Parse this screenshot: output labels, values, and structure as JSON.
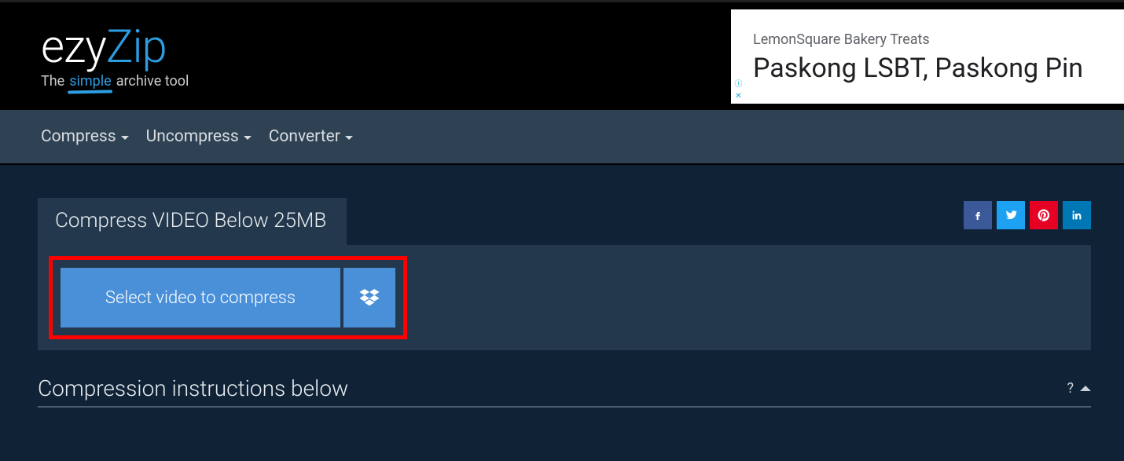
{
  "brand": {
    "part1": "ezy",
    "part2": "Zip",
    "tag_before": "The",
    "tag_highlight": "simple",
    "tag_after": "archive tool"
  },
  "ad": {
    "subtitle": "LemonSquare Bakery Treats",
    "headline": "Paskong LSBT, Paskong Pin"
  },
  "nav": {
    "items": [
      {
        "label": "Compress"
      },
      {
        "label": "Uncompress"
      },
      {
        "label": "Converter"
      }
    ]
  },
  "tab": {
    "title": "Compress VIDEO Below 25MB"
  },
  "select_button": {
    "label": "Select video to compress"
  },
  "instructions": {
    "title": "Compression instructions below",
    "help": "?"
  },
  "social": {
    "facebook": "facebook",
    "twitter": "twitter",
    "pinterest": "pinterest",
    "linkedin": "linkedin"
  }
}
